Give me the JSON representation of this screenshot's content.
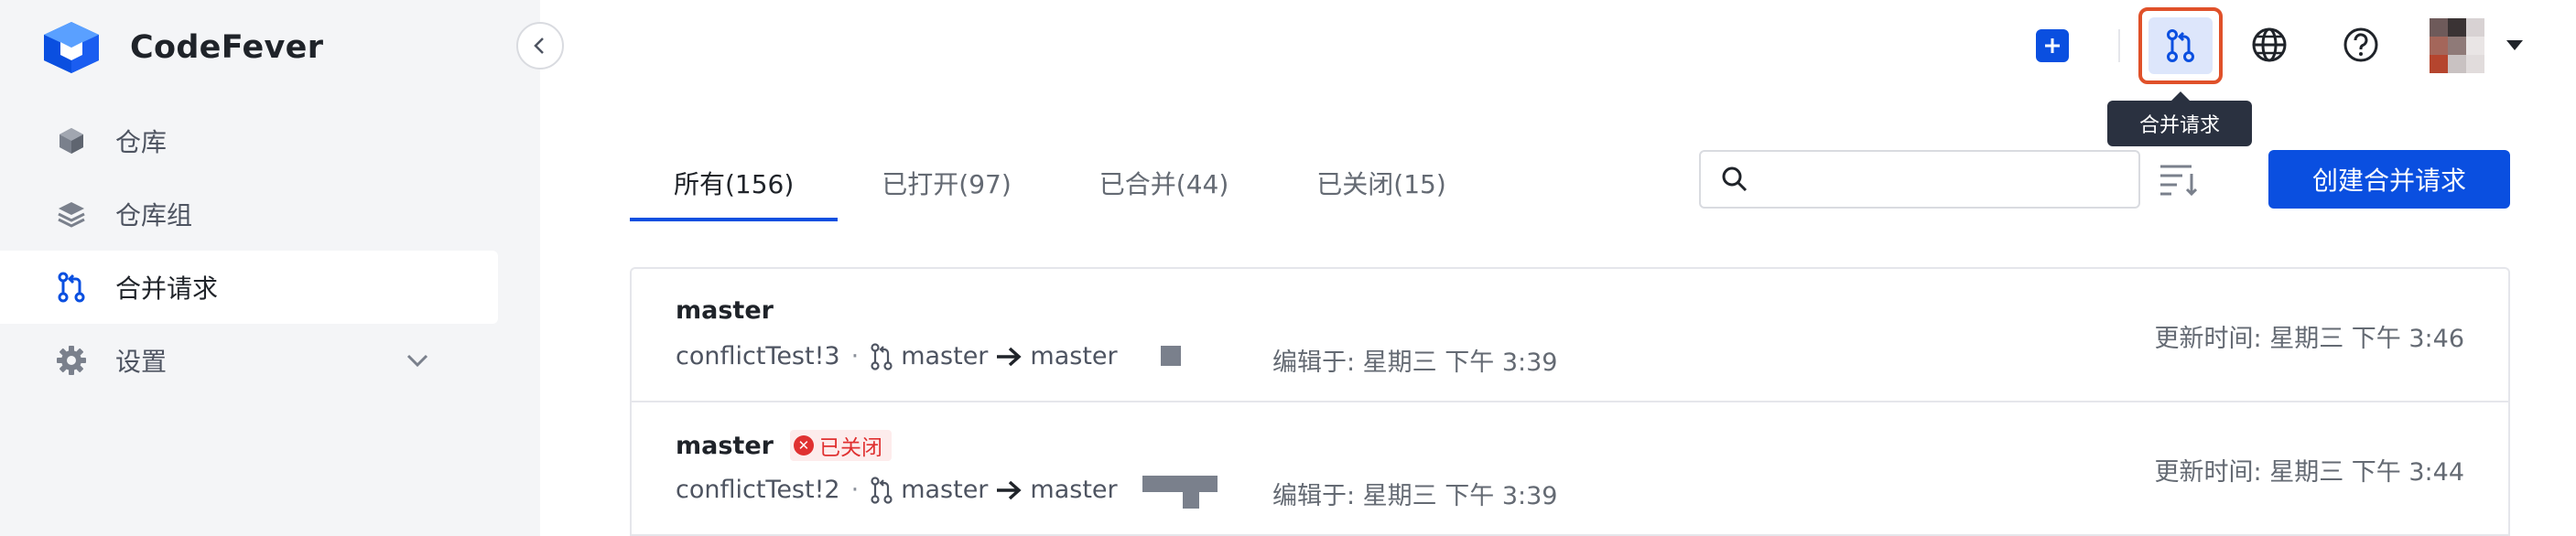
{
  "app": {
    "name": "CodeFever"
  },
  "sidebar": {
    "items": [
      {
        "label": "仓库",
        "icon": "cube-icon",
        "active": false
      },
      {
        "label": "仓库组",
        "icon": "layers-icon",
        "active": false
      },
      {
        "label": "合并请求",
        "icon": "merge-request-icon",
        "active": true
      },
      {
        "label": "设置",
        "icon": "gear-icon",
        "active": false,
        "expandable": true
      }
    ]
  },
  "header": {
    "tooltip": "合并请求",
    "icons": [
      "plus-icon",
      "merge-request-icon",
      "globe-icon",
      "help-icon",
      "avatar",
      "caret-down-icon"
    ],
    "avatar_colors": [
      "#6e5a5a",
      "#3a3334",
      "#d8d2d3",
      "#a4665a",
      "#8f7a78",
      "#e9e5e5",
      "#b5452e",
      "#c9c2c2",
      "#e1dcdc"
    ]
  },
  "tabs": [
    {
      "label": "所有(156)",
      "active": true
    },
    {
      "label": "已打开(97)",
      "active": false
    },
    {
      "label": "已合并(44)",
      "active": false
    },
    {
      "label": "已关闭(15)",
      "active": false
    }
  ],
  "search": {
    "placeholder": "",
    "value": ""
  },
  "create_button": "创建合并请求",
  "merge_requests": [
    {
      "title": "master",
      "status": "",
      "repo_ref": "conflictTest!3",
      "source": "master",
      "target": "master",
      "edited": "编辑于:  星期三 下午 3:39",
      "updated": "更新时间:  星期三 下午 3:46"
    },
    {
      "title": "master",
      "status": "已关闭",
      "repo_ref": "conflictTest!2",
      "source": "master",
      "target": "master",
      "edited": "编辑于:  星期三 下午 3:39",
      "updated": "更新时间:  星期三 下午 3:44"
    }
  ],
  "colors": {
    "accent": "#0a4fe0",
    "highlight_border": "#e0512a",
    "closed": "#e03131"
  },
  "separator": "·"
}
